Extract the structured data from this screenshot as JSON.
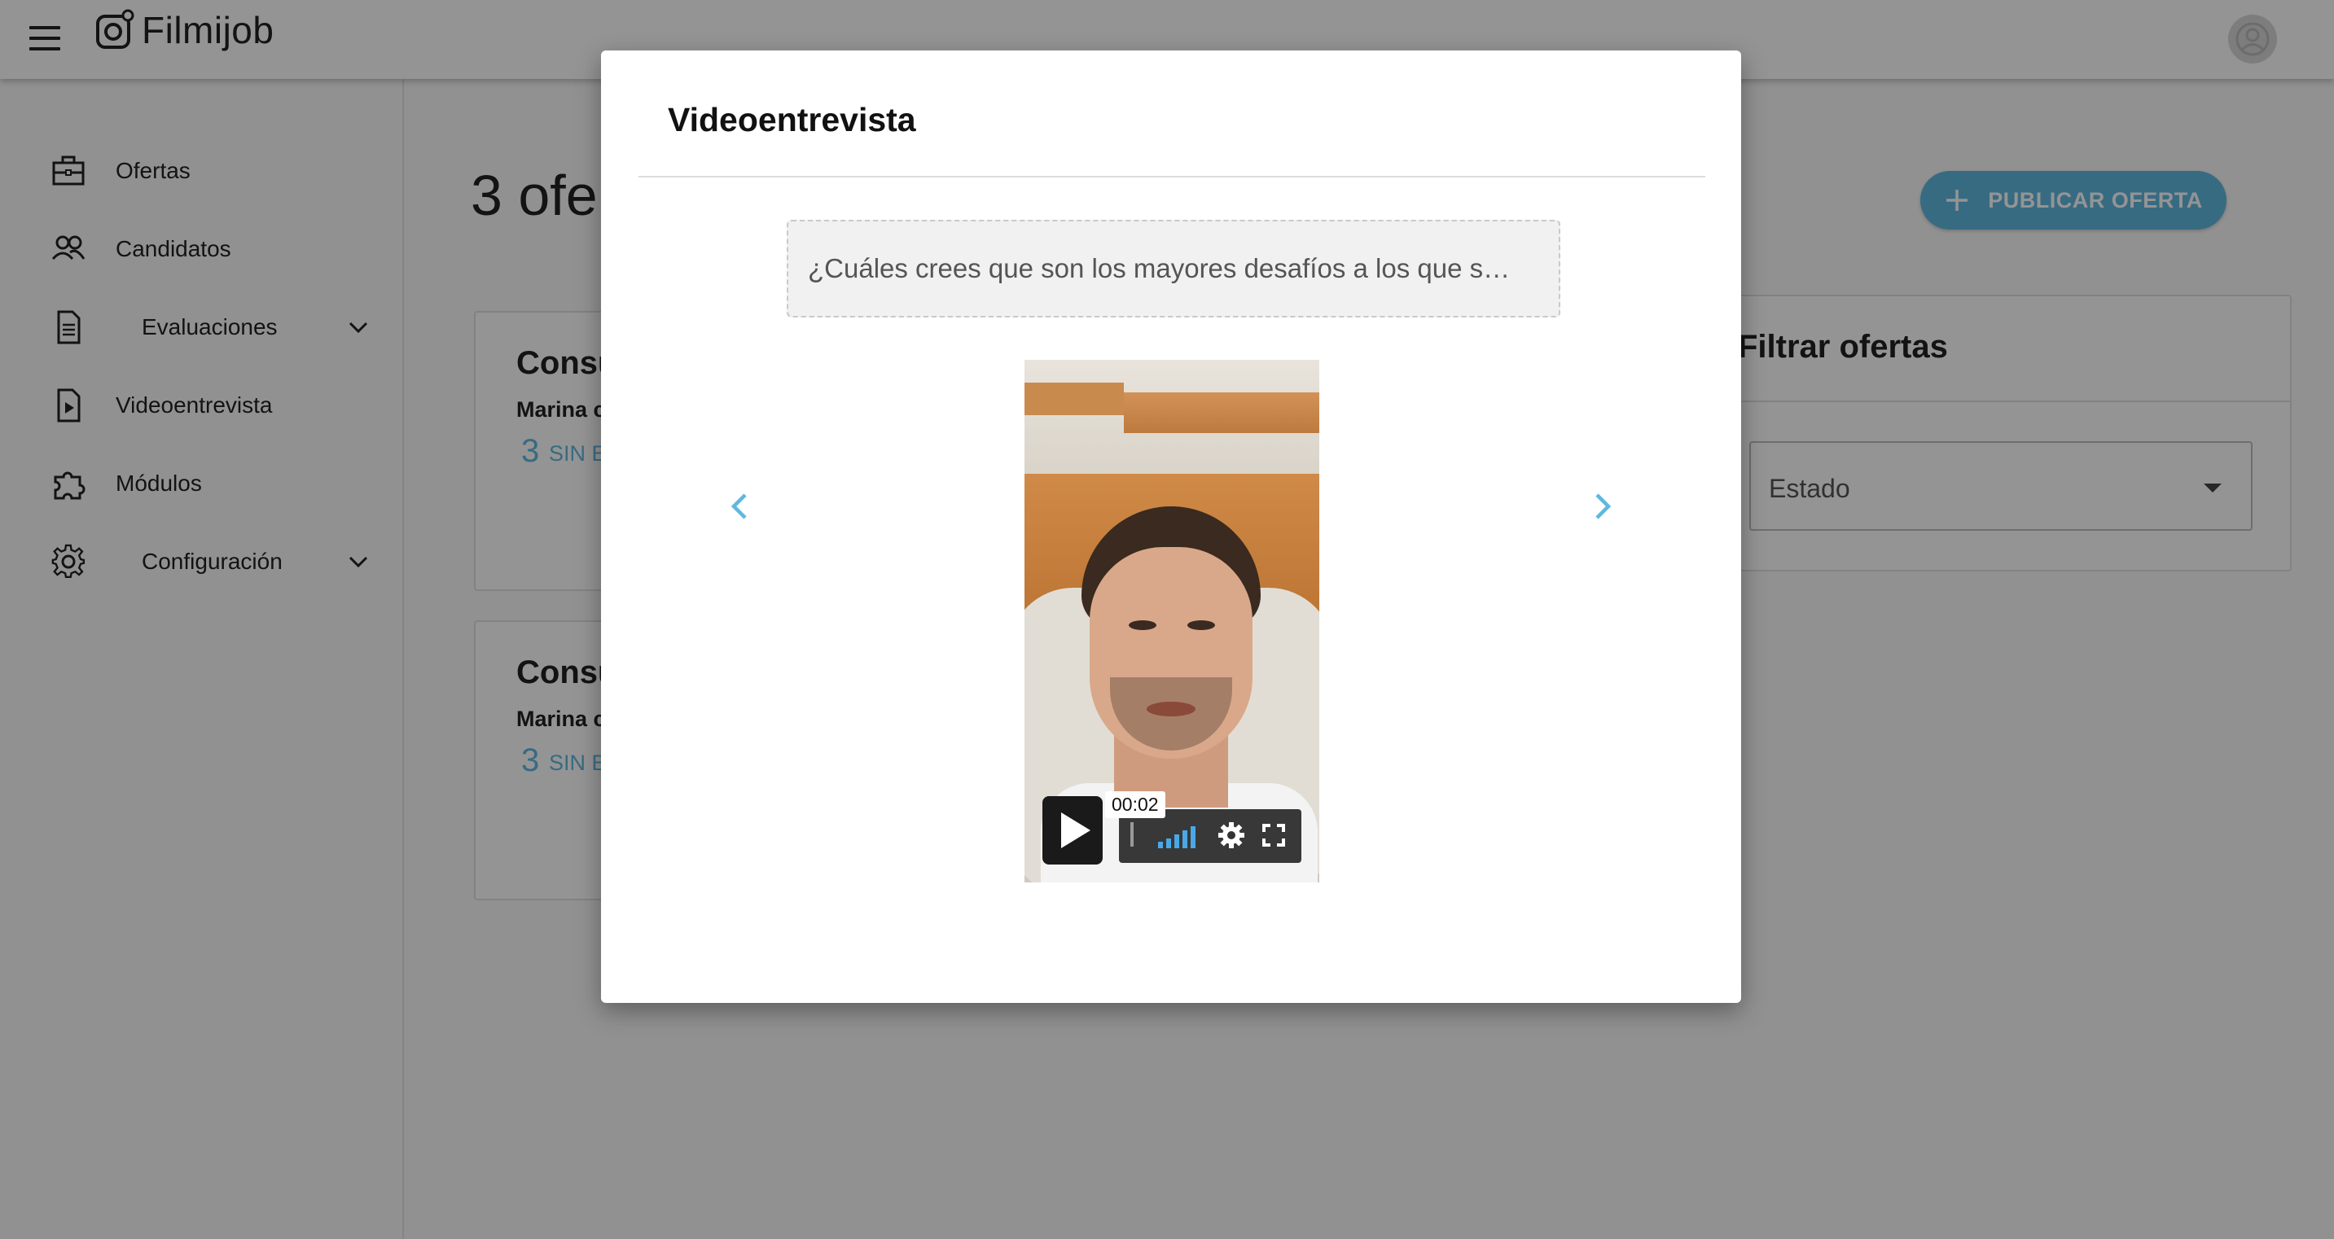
{
  "app": {
    "name": "Filmijob"
  },
  "colors": {
    "accent": "#5fb8e0",
    "overlay": "rgba(0,0,0,0.42)"
  },
  "sidebar": {
    "items": [
      {
        "label": "Ofertas",
        "icon": "briefcase-icon"
      },
      {
        "label": "Candidatos",
        "icon": "people-icon"
      },
      {
        "label": "Evaluaciones",
        "icon": "document-icon",
        "expandable": true
      },
      {
        "label": "Videoentrevista",
        "icon": "video-file-icon"
      },
      {
        "label": "Módulos",
        "icon": "puzzle-icon"
      },
      {
        "label": "Configuración",
        "icon": "gear-icon",
        "expandable": true
      }
    ]
  },
  "main": {
    "title": "3 ofe",
    "publish_button": "PUBLICAR OFERTA",
    "offers": [
      {
        "title": "Consu",
        "company": "Marina c",
        "count": "3",
        "status": "SIN E"
      },
      {
        "title": "Consu",
        "company": "Marina c",
        "count": "3",
        "status": "SIN E"
      }
    ],
    "filter": {
      "title": "Filtrar ofertas",
      "state_label": "Estado"
    }
  },
  "modal": {
    "title": "Videoentrevista",
    "question": "¿Cuáles crees que son los mayores desafíos a los que s…",
    "video": {
      "current_time": "00:02"
    }
  }
}
